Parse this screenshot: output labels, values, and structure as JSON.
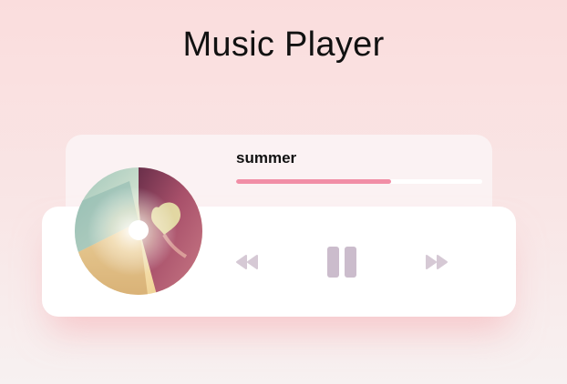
{
  "page": {
    "title": "Music Player"
  },
  "track": {
    "title": "summer",
    "progress": 0.63
  },
  "controls": {
    "rewind_icon": "rewind-icon",
    "pause_icon": "pause-icon",
    "forward_icon": "fast-forward-icon"
  },
  "colors": {
    "progress_fill": "#f18ea6",
    "icon": "#d6c9d5",
    "pause_icon": "#cbbccc"
  }
}
